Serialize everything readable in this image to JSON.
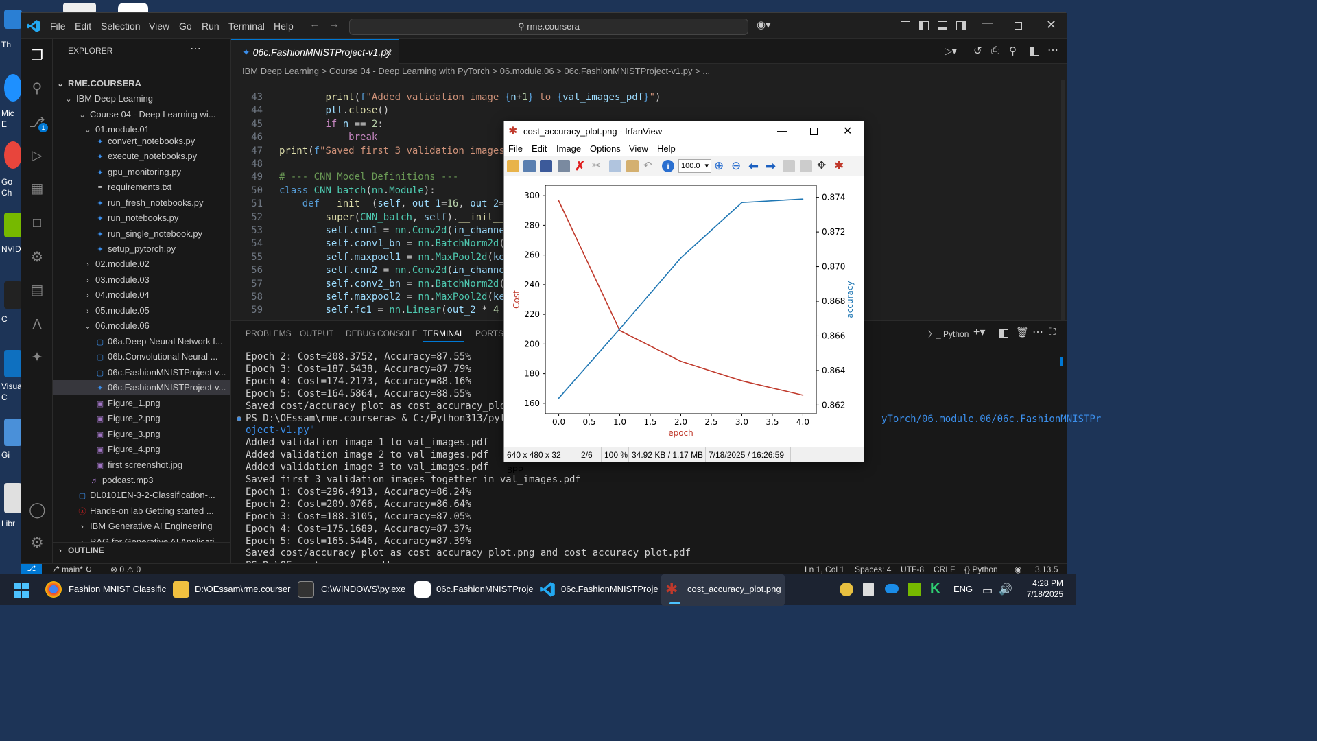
{
  "desktop": {
    "labels": [
      "Th",
      "Mic",
      "E",
      "Go",
      "Ch",
      "NVID",
      "C",
      "Visua",
      "C",
      "Gi",
      "Libr"
    ]
  },
  "vscode": {
    "menu": [
      "File",
      "Edit",
      "Selection",
      "View",
      "Go",
      "Run",
      "Terminal",
      "Help"
    ],
    "search": "rme.coursera",
    "explorer": {
      "title": "EXPLORER",
      "root": "RME.COURSERA",
      "items": [
        {
          "label": "IBM Deep Learning",
          "type": "folder-open"
        },
        {
          "label": "Course 04 - Deep Learning wi...",
          "type": "folder-open"
        },
        {
          "label": "01.module.01",
          "type": "folder-open"
        },
        {
          "label": "convert_notebooks.py",
          "type": "py"
        },
        {
          "label": "execute_notebooks.py",
          "type": "py"
        },
        {
          "label": "gpu_monitoring.py",
          "type": "py"
        },
        {
          "label": "requirements.txt",
          "type": "txt"
        },
        {
          "label": "run_fresh_notebooks.py",
          "type": "py"
        },
        {
          "label": "run_notebooks.py",
          "type": "py"
        },
        {
          "label": "run_single_notebook.py",
          "type": "py"
        },
        {
          "label": "setup_pytorch.py",
          "type": "py"
        },
        {
          "label": "02.module.02",
          "type": "folder"
        },
        {
          "label": "03.module.03",
          "type": "folder"
        },
        {
          "label": "04.module.04",
          "type": "folder"
        },
        {
          "label": "05.module.05",
          "type": "folder"
        },
        {
          "label": "06.module.06",
          "type": "folder-open"
        },
        {
          "label": "06a.Deep Neural Network f...",
          "type": "nb"
        },
        {
          "label": "06b.Convolutional Neural ...",
          "type": "nb"
        },
        {
          "label": "06c.FashionMNISTProject-v...",
          "type": "nb"
        },
        {
          "label": "06c.FashionMNISTProject-v...",
          "type": "py"
        },
        {
          "label": "Figure_1.png",
          "type": "img"
        },
        {
          "label": "Figure_2.png",
          "type": "img"
        },
        {
          "label": "Figure_3.png",
          "type": "img"
        },
        {
          "label": "Figure_4.png",
          "type": "img"
        },
        {
          "label": "first screenshot.jpg",
          "type": "img"
        },
        {
          "label": "podcast.mp3",
          "type": "audio"
        },
        {
          "label": "DL0101EN-3-2-Classification-...",
          "type": "nb"
        },
        {
          "label": "Hands-on lab Getting started ...",
          "type": "pdf"
        },
        {
          "label": "IBM Generative AI Engineering",
          "type": "folder"
        },
        {
          "label": "RAG for Generative AI Applicati...",
          "type": "folder"
        }
      ],
      "outline": "OUTLINE",
      "timeline": "TIMELINE"
    },
    "tab": "06c.FashionMNISTProject-v1.py",
    "breadcrumb": "IBM Deep Learning  >  Course 04 - Deep Learning with PyTorch  >  06.module.06  >  06c.FashionMNISTProject-v1.py  >  ...",
    "code": [
      {
        "n": "43",
        "h": "        <span class=\"fn\">print</span>(<span class=\"kw\">f</span><span class=\"str\">\"Added validation image </span><span class=\"kw\">{</span><span class=\"var\">n</span>+<span class=\"num\">1</span><span class=\"kw\">}</span><span class=\"str\"> to </span><span class=\"kw\">{</span><span class=\"var\">val_images_pdf</span><span class=\"kw\">}</span><span class=\"str\">\"</span>)"
      },
      {
        "n": "44",
        "h": "        <span class=\"var\">plt</span>.<span class=\"fn\">close</span>()"
      },
      {
        "n": "45",
        "h": "        <span class=\"kw2\">if</span> <span class=\"var\">n</span> == <span class=\"num\">2</span>:"
      },
      {
        "n": "46",
        "h": "            <span class=\"kw2\">break</span>"
      },
      {
        "n": "47",
        "h": "<span class=\"fn\">print</span>(<span class=\"kw\">f</span><span class=\"str\">\"Saved first 3 validation images togeth</span>"
      },
      {
        "n": "48",
        "h": ""
      },
      {
        "n": "49",
        "h": "<span class=\"cm\"># --- CNN Model Definitions ---</span>"
      },
      {
        "n": "50",
        "h": "<span class=\"kw\">class</span> <span class=\"cls\">CNN_batch</span>(<span class=\"cls\">nn</span>.<span class=\"cls\">Module</span>):"
      },
      {
        "n": "51",
        "h": "    <span class=\"kw\">def</span> <span class=\"fn\">__init__</span>(<span class=\"var\">self</span>, <span class=\"var\">out_1</span>=<span class=\"num\">16</span>, <span class=\"var\">out_2</span>=<span class=\"num\">32</span>, <span class=\"var\">num</span>"
      },
      {
        "n": "52",
        "h": "        <span class=\"fn\">super</span>(<span class=\"cls\">CNN_batch</span>, <span class=\"var\">self</span>).<span class=\"fn\">__init__</span>()"
      },
      {
        "n": "53",
        "h": "        <span class=\"var\">self</span>.<span class=\"var\">cnn1</span> = <span class=\"cls\">nn</span>.<span class=\"cls\">Conv2d</span>(<span class=\"var\">in_channels</span>=<span class=\"num\">1</span>, <span class=\"var\">o</span>"
      },
      {
        "n": "54",
        "h": "        <span class=\"var\">self</span>.<span class=\"var\">conv1_bn</span> = <span class=\"cls\">nn</span>.<span class=\"cls\">BatchNorm2d</span>(<span class=\"var\">out_1</span>)"
      },
      {
        "n": "55",
        "h": "        <span class=\"var\">self</span>.<span class=\"var\">maxpool1</span> = <span class=\"cls\">nn</span>.<span class=\"cls\">MaxPool2d</span>(<span class=\"var\">kernel_si</span>"
      },
      {
        "n": "56",
        "h": "        <span class=\"var\">self</span>.<span class=\"var\">cnn2</span> = <span class=\"cls\">nn</span>.<span class=\"cls\">Conv2d</span>(<span class=\"var\">in_channels</span>=<span class=\"var\">out</span>"
      },
      {
        "n": "57",
        "h": "        <span class=\"var\">self</span>.<span class=\"var\">conv2_bn</span> = <span class=\"cls\">nn</span>.<span class=\"cls\">BatchNorm2d</span>(<span class=\"var\">out_2</span>)"
      },
      {
        "n": "58",
        "h": "        <span class=\"var\">self</span>.<span class=\"var\">maxpool2</span> = <span class=\"cls\">nn</span>.<span class=\"cls\">MaxPool2d</span>(<span class=\"var\">kernel_si</span>"
      },
      {
        "n": "59",
        "h": "        <span class=\"var\">self</span>.<span class=\"var\">fc1</span> = <span class=\"cls\">nn</span>.<span class=\"cls\">Linear</span>(<span class=\"var\">out_2</span> * <span class=\"num\">4</span> * <span class=\"num\">4</span>, <span class=\"var\">nu</span>"
      }
    ],
    "panel_tabs": [
      "PROBLEMS",
      "OUTPUT",
      "DEBUG CONSOLE",
      "TERMINAL",
      "PORTS",
      "AZ"
    ],
    "terminal_shell": "Python",
    "terminal": [
      "Epoch 2: Cost=208.3752, Accuracy=87.55%",
      "Epoch 3: Cost=187.5438, Accuracy=87.79%",
      "Epoch 4: Cost=174.2173, Accuracy=88.16%",
      "Epoch 5: Cost=164.5864, Accuracy=88.55%",
      "Saved cost/accuracy plot as cost_accuracy_plot.png and c",
      "PS D:\\OEssam\\rme.coursera> & C:/Python313/python.exe \"d",
      "oject-v1.py\"",
      "Added validation image 1 to val_images.pdf",
      "Added validation image 2 to val_images.pdf",
      "Added validation image 3 to val_images.pdf",
      "Saved first 3 validation images together in val_images.pdf",
      "Epoch 1: Cost=296.4913, Accuracy=86.24%",
      "Epoch 2: Cost=209.0766, Accuracy=86.64%",
      "Epoch 3: Cost=188.3105, Accuracy=87.05%",
      "Epoch 4: Cost=175.1689, Accuracy=87.37%",
      "Epoch 5: Cost=165.5446, Accuracy=87.39%",
      "Saved cost/accuracy plot as cost_accuracy_plot.png and cost_accuracy_plot.pdf",
      "PS D:\\OEssam\\rme.coursera> "
    ],
    "terminal_right": "yTorch/06.module.06/06c.FashionMNISTPr",
    "status": {
      "branch": "main*",
      "problems": "⊗ 0 ⚠ 0",
      "position": "Ln 1, Col 1",
      "spaces": "Spaces: 4",
      "encoding": "UTF-8",
      "eol": "CRLF",
      "language": "{} Python",
      "version": "3.13.5"
    }
  },
  "irfanview": {
    "title": "cost_accuracy_plot.png - IrfanView",
    "menu": [
      "File",
      "Edit",
      "Image",
      "Options",
      "View",
      "Help"
    ],
    "zoom": "100.0",
    "status": [
      "640 x 480 x 32 BPP",
      "2/6",
      "100 %",
      "34.92 KB / 1.17 MB",
      "7/18/2025 / 16:26:59"
    ]
  },
  "chart_data": {
    "type": "line",
    "title": "",
    "xlabel": "epoch",
    "ylabel": "Cost",
    "y2label": "accuracy",
    "x": [
      0,
      1,
      2,
      3,
      4
    ],
    "xticks": [
      "0.0",
      "0.5",
      "1.0",
      "1.5",
      "2.0",
      "2.5",
      "3.0",
      "3.5",
      "4.0"
    ],
    "yticks": [
      "160",
      "180",
      "200",
      "220",
      "240",
      "260",
      "280",
      "300"
    ],
    "y2ticks": [
      "0.862",
      "0.864",
      "0.866",
      "0.868",
      "0.870",
      "0.872",
      "0.874"
    ],
    "xlim": [
      -0.22,
      4.22
    ],
    "ylim": [
      153,
      307
    ],
    "y2lim": [
      0.8615,
      0.8747
    ],
    "series": [
      {
        "axis": "left",
        "color": "#c0392b",
        "values": [
          296.49,
          209.08,
          188.31,
          175.17,
          165.54
        ]
      },
      {
        "axis": "right",
        "color": "#1f77b4",
        "values": [
          0.8624,
          0.8664,
          0.8705,
          0.8737,
          0.8739
        ]
      }
    ]
  },
  "taskbar": {
    "items": [
      "Fashion MNIST Classific",
      "D:\\OEssam\\rme.courser",
      "C:\\WINDOWS\\py.exe",
      "06c.FashionMNISTProje",
      "06c.FashionMNISTProje",
      "cost_accuracy_plot.png"
    ],
    "lang": "ENG",
    "time": "4:28 PM",
    "date": "7/18/2025"
  }
}
